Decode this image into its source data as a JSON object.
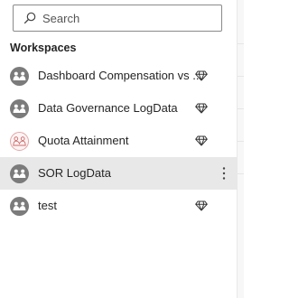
{
  "search": {
    "placeholder": "Search",
    "value": ""
  },
  "section": {
    "title": "Workspaces"
  },
  "workspaces": [
    {
      "label": "Dashboard Compensation vs ...",
      "avatar_style": "gray",
      "premium": true,
      "selected": false
    },
    {
      "label": "Data Governance LogData",
      "avatar_style": "gray",
      "premium": true,
      "selected": false
    },
    {
      "label": "Quota Attainment",
      "avatar_style": "light-red",
      "premium": true,
      "selected": false
    },
    {
      "label": "SOR LogData",
      "avatar_style": "gray",
      "premium": false,
      "selected": true,
      "more_menu": "⋮"
    },
    {
      "label": "test",
      "avatar_style": "gray",
      "premium": true,
      "selected": false
    }
  ],
  "icons": {
    "search": "search-icon",
    "workspace_avatar": "workspace-people-icon",
    "premium": "diamond-icon",
    "more": "more-vertical-icon"
  },
  "colors": {
    "selected_row": "#e8e8e8",
    "avatar_gray": "#7b7b7b",
    "avatar_light_border": "#e3a6a6",
    "text": "#252525"
  }
}
